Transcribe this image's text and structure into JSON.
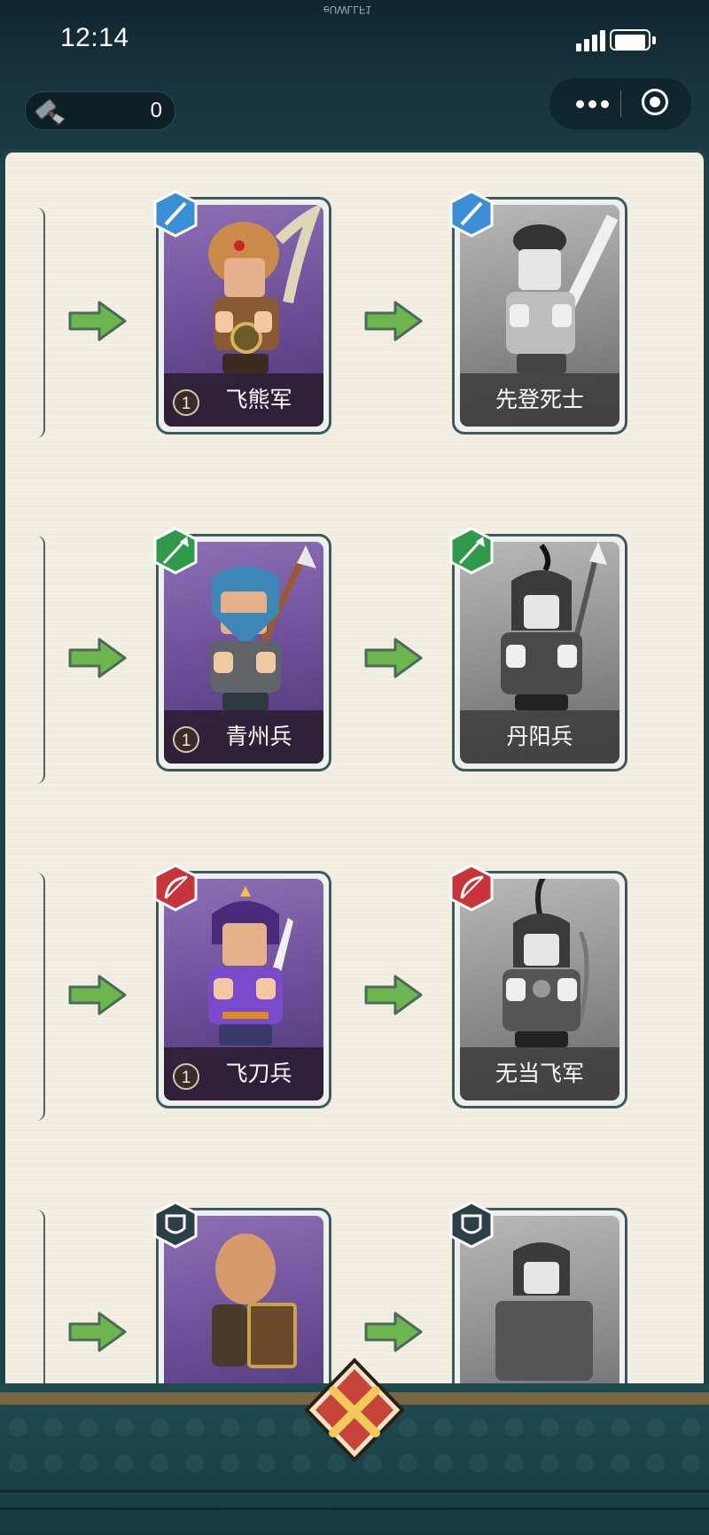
{
  "status_bar": {
    "time": "12:14",
    "top_text": "eUWLLF1"
  },
  "resource": {
    "icon": "hammer-icon",
    "value": "0"
  },
  "capsule": {
    "more_icon": "more-dots-icon",
    "close_icon": "target-icon"
  },
  "rows": [
    {
      "from": {
        "name": "飞熊军",
        "level": "1",
        "type_icon": "sword-badge-icon",
        "type_color": "#3b8fd6"
      },
      "to": {
        "name": "先登死士",
        "type_icon": "sword-badge-icon",
        "type_color": "#3b8fd6"
      }
    },
    {
      "from": {
        "name": "青州兵",
        "level": "1",
        "type_icon": "spear-badge-icon",
        "type_color": "#2f9a4a"
      },
      "to": {
        "name": "丹阳兵",
        "type_icon": "spear-badge-icon",
        "type_color": "#2f9a4a"
      }
    },
    {
      "from": {
        "name": "飞刀兵",
        "level": "1",
        "type_icon": "bow-badge-icon",
        "type_color": "#c8343a"
      },
      "to": {
        "name": "无当飞军",
        "type_icon": "bow-badge-icon",
        "type_color": "#c8343a"
      }
    },
    {
      "from": {
        "name": "",
        "level": "",
        "type_icon": "shield-badge-icon",
        "type_color": "#2a3f46"
      },
      "to": {
        "name": "",
        "type_icon": "shield-badge-icon",
        "type_color": "#2a3f46"
      }
    }
  ],
  "colors": {
    "arrow": "#6cb54f",
    "owned_card": "#6a4c95",
    "locked_card": "#8d8d8d",
    "panel": "#f3efe3"
  },
  "bottom": {
    "center_icon": "crossed-swords-icon"
  }
}
